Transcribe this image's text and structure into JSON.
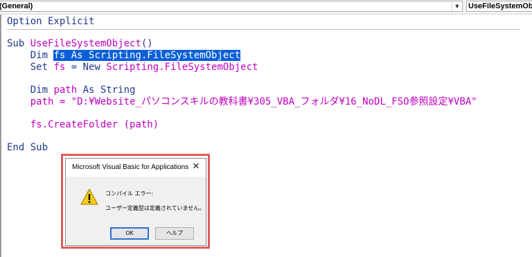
{
  "toolbar": {
    "object_combo": "(General)",
    "procedure_combo": "UseFileSystemObje"
  },
  "code": {
    "option_kw": "Option",
    "option_rest": " Explicit",
    "sub_kw": "Sub",
    "sub_name": " UseFileSystemObject",
    "sub_paren": "()",
    "dim1_kw": "    Dim ",
    "dim1_sel": "fs As Scripting.FileSystemObject",
    "set_kw": "    Set ",
    "set_var": "fs",
    "set_eq": " = ",
    "set_new": "New",
    "set_type": " Scripting.FileSystemObject",
    "dim2_kw": "    Dim ",
    "dim2_var": "path",
    "dim2_as": " As",
    "dim2_type": " String",
    "path_var": "    path",
    "path_value": " = \"D:¥Website_パソコンスキルの教科書¥305_VBA_フォルダ¥16_NoDL_FSO参照設定¥VBA\"",
    "create_obj": "    fs.CreateFolder",
    "create_args": " (path)",
    "end_sub": "End Sub"
  },
  "dialog": {
    "title": "Microsoft Visual Basic for Applications",
    "close_glyph": "✕",
    "message_line1": "コンパイル エラー:",
    "message_line2": "ユーザー定義型は定義されていません。",
    "ok_label": "OK",
    "help_label": "ヘルプ",
    "icon": "warning-icon",
    "highlight_color": "#e15b5b"
  },
  "colors": {
    "selection": "#0a5fd8",
    "keyword": "#1f3a8a",
    "identifier": "#c000c0"
  }
}
